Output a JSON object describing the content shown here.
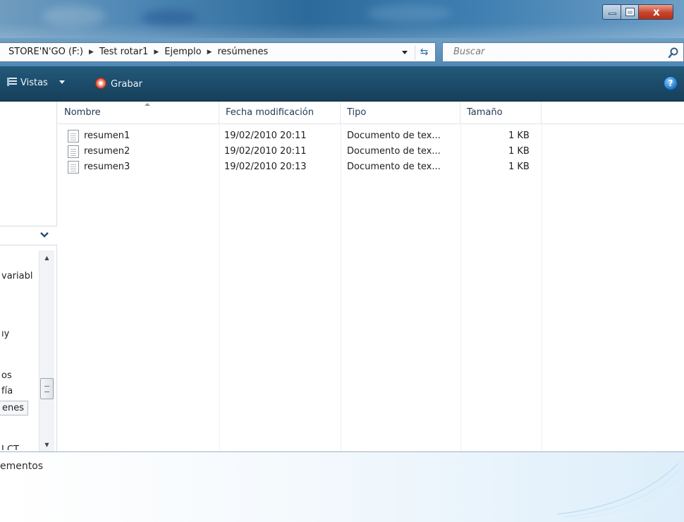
{
  "window": {
    "minimize_label": "",
    "maximize_label": "",
    "close_label": "x"
  },
  "address": {
    "crumbs": [
      "STORE'N'GO (F:)",
      "Test rotar1",
      "Ejemplo",
      "resúmenes"
    ]
  },
  "search": {
    "placeholder": "Buscar"
  },
  "toolbar": {
    "views_label": "Vistas",
    "burn_label": "Grabar",
    "help_label": "?"
  },
  "nav": {
    "items": [
      "variabl",
      "ıy",
      "os",
      "fía",
      "enes",
      "J CT"
    ]
  },
  "columns": {
    "name": "Nombre",
    "modified": "Fecha modificación",
    "type": "Tipo",
    "size": "Tamaño"
  },
  "files": [
    {
      "name": "resumen1",
      "modified": "19/02/2010 20:11",
      "type": "Documento de tex...",
      "size": "1 KB"
    },
    {
      "name": "resumen2",
      "modified": "19/02/2010 20:11",
      "type": "Documento de tex...",
      "size": "1 KB"
    },
    {
      "name": "resumen3",
      "modified": "19/02/2010 20:13",
      "type": "Documento de tex...",
      "size": "1 KB"
    }
  ],
  "details": {
    "text": "ementos"
  },
  "colors": {
    "toolbar": "#1d4d6c",
    "titlebar": "#2c6a9b",
    "close": "#c8432a"
  }
}
